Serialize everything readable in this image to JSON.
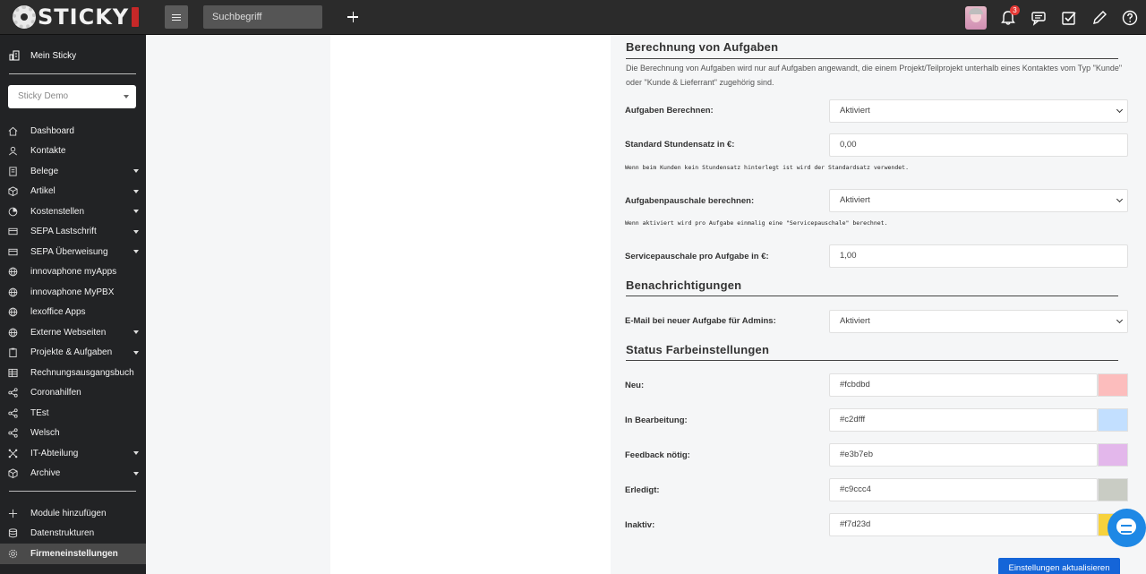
{
  "app": {
    "logo_text": "STICKY"
  },
  "topbar": {
    "search_placeholder": "Suchbegriff",
    "notification_count": "3"
  },
  "sidebar": {
    "top_item": "Mein Sticky",
    "tenant": "Sticky Demo",
    "items": [
      {
        "label": "Dashboard",
        "icon": "home-icon",
        "expandable": false
      },
      {
        "label": "Kontakte",
        "icon": "contacts-icon",
        "expandable": false
      },
      {
        "label": "Belege",
        "icon": "document-icon",
        "expandable": true
      },
      {
        "label": "Artikel",
        "icon": "box-icon",
        "expandable": true
      },
      {
        "label": "Kostenstellen",
        "icon": "pie-icon",
        "expandable": true
      },
      {
        "label": "SEPA Lastschrift",
        "icon": "card-icon",
        "expandable": true
      },
      {
        "label": "SEPA Überweisung",
        "icon": "card-icon",
        "expandable": true
      },
      {
        "label": "innovaphone myApps",
        "icon": "globe-icon",
        "expandable": false
      },
      {
        "label": "innovaphone MyPBX",
        "icon": "globe-icon",
        "expandable": false
      },
      {
        "label": "lexoffice Apps",
        "icon": "globe-icon",
        "expandable": false
      },
      {
        "label": "Externe Webseiten",
        "icon": "globe-icon",
        "expandable": true
      },
      {
        "label": "Projekte & Aufgaben",
        "icon": "clipboard-icon",
        "expandable": true
      },
      {
        "label": "Rechnungsausgangsbuch",
        "icon": "table-icon",
        "expandable": false
      },
      {
        "label": "Coronahilfen",
        "icon": "share-icon",
        "expandable": false
      },
      {
        "label": "TEst",
        "icon": "share-icon",
        "expandable": false
      },
      {
        "label": "Welsch",
        "icon": "share-icon",
        "expandable": false
      },
      {
        "label": "IT-Abteilung",
        "icon": "network-icon",
        "expandable": true
      },
      {
        "label": "Archive",
        "icon": "box-icon",
        "expandable": true
      }
    ],
    "bottom": [
      {
        "label": "Module hinzufügen",
        "icon": "plus-icon"
      },
      {
        "label": "Datenstrukturen",
        "icon": "database-icon"
      },
      {
        "label": "Firmeneinstellungen",
        "icon": "gear-icon",
        "active": true
      }
    ]
  },
  "settings": {
    "tasks": {
      "title": "Berechnung von Aufgaben",
      "description": "Die Berechnung von Aufgaben wird nur auf Aufgaben angewandt, die einem Projekt/Teilprojekt unterhalb eines Kontaktes vom Typ \"Kunde\" oder \"Kunde & Lieferrant\" zugehörig sind.",
      "calc_label": "Aufgaben Berechnen:",
      "calc_value": "Aktiviert",
      "rate_label": "Standard Stundensatz in €:",
      "rate_value": "0,00",
      "rate_help": "Wenn beim Kunden kein Stundensatz hinterlegt ist wird der Standardsatz verwendet.",
      "flat_label": "Aufgabenpauschale berechnen:",
      "flat_value": "Aktiviert",
      "flat_help": "Wenn aktiviert wird pro Aufgabe einmalig eine \"Servicepauschale\" berechnet.",
      "service_label": "Servicepauschale pro Aufgabe in €:",
      "service_value": "1,00"
    },
    "notifications": {
      "title": "Benachrichtigungen",
      "email_label": "E-Mail bei neuer Aufgabe für Admins:",
      "email_value": "Aktiviert"
    },
    "status_colors": {
      "title": "Status Farbeinstellungen",
      "rows": [
        {
          "label": "Neu:",
          "value": "#fcbdbd"
        },
        {
          "label": "In Bearbeitung:",
          "value": "#c2dfff"
        },
        {
          "label": "Feedback nötig:",
          "value": "#e3b7eb"
        },
        {
          "label": "Erledigt:",
          "value": "#c9ccc4"
        },
        {
          "label": "Inaktiv:",
          "value": "#f7d23d"
        }
      ]
    },
    "submit_label": "Einstellungen aktualisieren"
  }
}
